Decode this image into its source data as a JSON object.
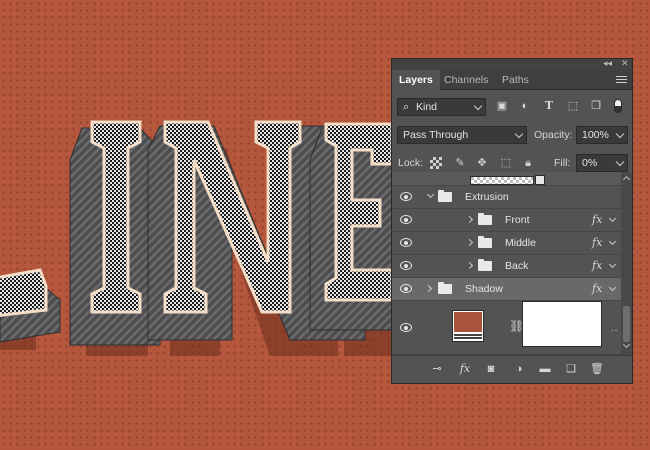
{
  "canvas": {
    "background_color": "#b4573c"
  },
  "panel": {
    "topbar": {
      "collapse_glyph": "◂◂",
      "close_glyph": "✕"
    },
    "tabs": [
      {
        "label": "Layers",
        "active": true
      },
      {
        "label": "Channels",
        "active": false
      },
      {
        "label": "Paths",
        "active": false
      }
    ],
    "filter": {
      "kind_label": "Kind",
      "icons": [
        "image-filter-icon",
        "adjustment-filter-icon",
        "type-filter-icon",
        "shape-filter-icon",
        "smartobject-filter-icon",
        "filter-toggle-icon"
      ]
    },
    "blend_mode": "Pass Through",
    "opacity_label": "Opacity:",
    "opacity_value": "100%",
    "lock_label": "Lock:",
    "fill_label": "Fill:",
    "fill_value": "0%",
    "layers": [
      {
        "name": "",
        "type": "partial-top",
        "visible": false
      },
      {
        "name": "Extrusion",
        "type": "group",
        "expanded": true,
        "indent": 0,
        "fx": false,
        "visible": true
      },
      {
        "name": "Front",
        "type": "group",
        "expanded": false,
        "indent": 1,
        "fx": true,
        "visible": true
      },
      {
        "name": "Middle",
        "type": "group",
        "expanded": false,
        "indent": 1,
        "fx": true,
        "visible": true
      },
      {
        "name": "Back",
        "type": "group",
        "expanded": false,
        "indent": 1,
        "fx": true,
        "visible": true
      },
      {
        "name": "Shadow",
        "type": "group",
        "expanded": false,
        "indent": 0,
        "fx": true,
        "visible": true,
        "selected": true
      },
      {
        "name": "",
        "type": "adjustment-with-mask",
        "swatch_color": "#a8533a",
        "visible": true
      }
    ],
    "bottom_icons": [
      "link-layers-icon",
      "add-style-icon",
      "add-mask-icon",
      "new-adjustment-icon",
      "new-group-icon",
      "new-layer-icon",
      "delete-layer-icon"
    ]
  }
}
